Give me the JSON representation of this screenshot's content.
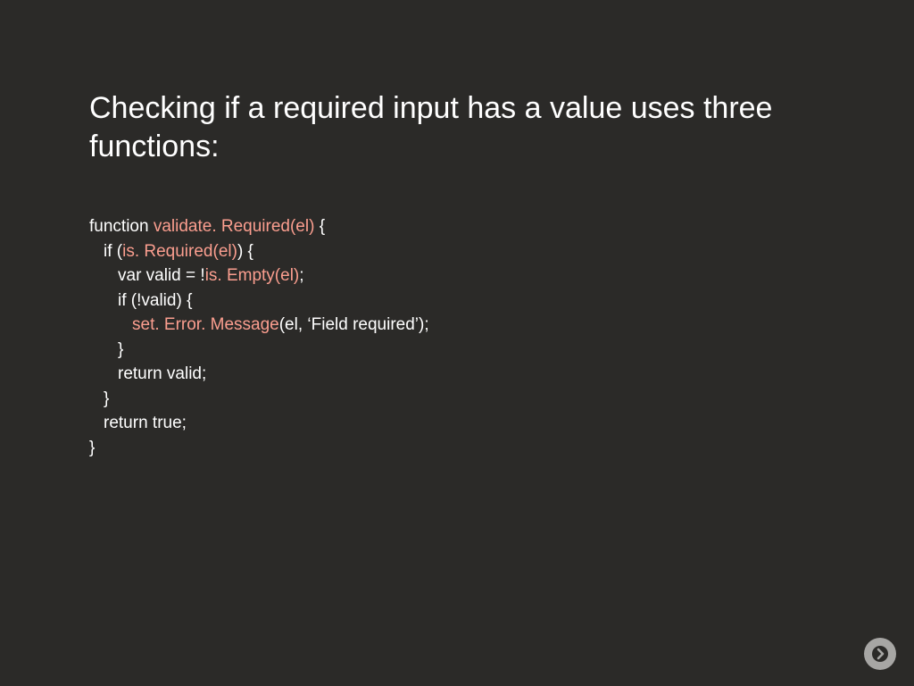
{
  "heading": "Checking if a required input has a value uses three functions:",
  "code": {
    "l1a": "function ",
    "l1b": "validate. Required(el)",
    "l1c": " {",
    "l2a": "if (",
    "l2b": "is. Required(el)",
    "l2c": ") {",
    "l3a": "var valid = !",
    "l3b": "is. Empty(el)",
    "l3c": ";",
    "l4": "if (!valid) {",
    "l5a": "set. Error. Message",
    "l5b": "(el, ‘Field required’);",
    "l6": "}",
    "l7": "return valid;",
    "l8": "}",
    "l9": "return true;",
    "l10": "}"
  }
}
